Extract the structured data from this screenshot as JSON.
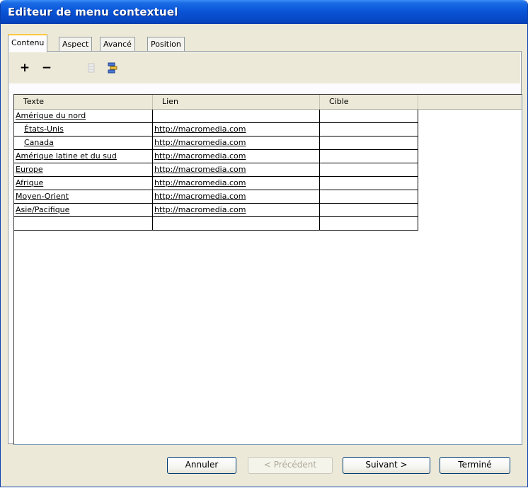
{
  "window": {
    "title": "Editeur de menu contextuel"
  },
  "tabs": [
    {
      "label": "Contenu",
      "active": true
    },
    {
      "label": "Aspect",
      "active": false
    },
    {
      "label": "Avancé",
      "active": false
    },
    {
      "label": "Position",
      "active": false
    }
  ],
  "toolbar": {
    "add_glyph": "+",
    "remove_glyph": "−"
  },
  "grid": {
    "columns": [
      "Texte",
      "Lien",
      "Cible"
    ],
    "rows": [
      {
        "text": "Amérique du nord",
        "link": "",
        "target": "",
        "indent": false
      },
      {
        "text": "États-Unis",
        "link": "http://macromedia.com",
        "target": "",
        "indent": true
      },
      {
        "text": "Canada",
        "link": "http://macromedia.com",
        "target": "",
        "indent": true
      },
      {
        "text": "Amérique latine et du sud",
        "link": "http://macromedia.com",
        "target": "",
        "indent": false
      },
      {
        "text": "Europe",
        "link": "http://macromedia.com",
        "target": "",
        "indent": false
      },
      {
        "text": "Afrique",
        "link": "http://macromedia.com",
        "target": "",
        "indent": false
      },
      {
        "text": "Moyen-Orient",
        "link": "http://macromedia.com",
        "target": "",
        "indent": false
      },
      {
        "text": "Asie/Pacifique",
        "link": "http://macromedia.com",
        "target": "",
        "indent": false
      },
      {
        "text": "",
        "link": "",
        "target": "",
        "indent": false
      }
    ]
  },
  "buttons": {
    "cancel": "Annuler",
    "previous": "< Précédent",
    "next": "Suivant >",
    "done": "Terminé"
  },
  "colors": {
    "titlebar": "#0a55d8",
    "active_tab_accent": "#ffc83c",
    "dialog_bg": "#ece9d8"
  }
}
